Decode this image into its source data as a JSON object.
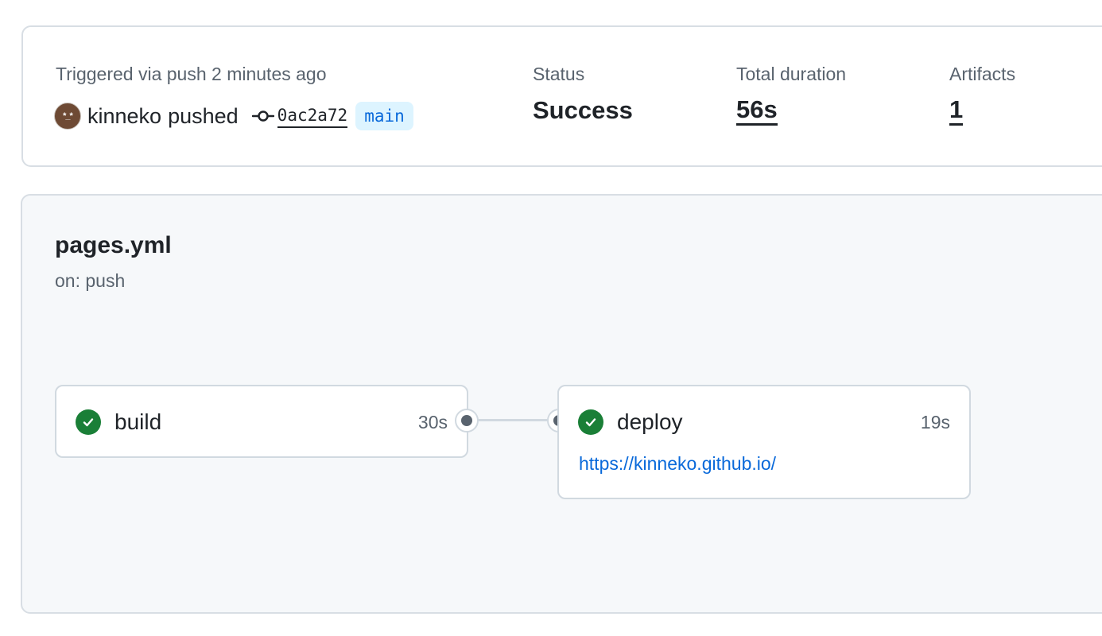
{
  "summary": {
    "triggered_text": "Triggered via push 2 minutes ago",
    "actor": {
      "avatar_glyph": "*_*",
      "name": "kinneko",
      "action": "pushed"
    },
    "commit_icon": "git-commit-icon",
    "commit_sha": "0ac2a72",
    "branch": "main",
    "status": {
      "label": "Status",
      "value": "Success"
    },
    "duration": {
      "label": "Total duration",
      "value": "56s"
    },
    "artifacts": {
      "label": "Artifacts",
      "value": "1"
    }
  },
  "workflow": {
    "name": "pages.yml",
    "trigger": "on: push",
    "jobs": [
      {
        "name": "build",
        "duration": "30s",
        "status": "success",
        "status_icon": "check-circle-icon"
      },
      {
        "name": "deploy",
        "duration": "19s",
        "status": "success",
        "status_icon": "check-circle-icon",
        "url": "https://kinneko.github.io/"
      }
    ]
  },
  "colors": {
    "success": "#1a7f37",
    "link": "#0969da",
    "branch_badge_bg": "#ddf4ff",
    "muted_text": "#59636e",
    "border": "#d8dee4",
    "canvas_bg": "#f6f8fa"
  }
}
